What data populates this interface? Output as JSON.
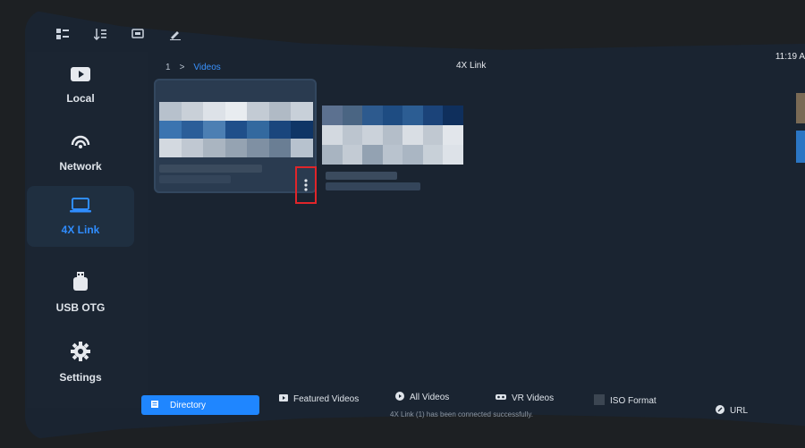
{
  "topbar": {
    "icons": [
      "grid-list-icon",
      "sort-icon",
      "screen-icon",
      "edit-icon"
    ]
  },
  "sidebar": {
    "items": [
      {
        "label": "Local",
        "icon": "play-folder-icon"
      },
      {
        "label": "Network",
        "icon": "network-icon"
      },
      {
        "label": "4X Link",
        "icon": "laptop-icon",
        "active": true
      },
      {
        "label": "USB OTG",
        "icon": "usb-icon"
      },
      {
        "label": "Settings",
        "icon": "gear-icon"
      }
    ]
  },
  "header": {
    "breadcrumb_root": "1",
    "breadcrumb_sep": ">",
    "breadcrumb_current": "Videos",
    "title": "4X Link",
    "clock": "11:19 A"
  },
  "bottom": {
    "tabs": [
      {
        "label": "Directory",
        "icon": "directory-icon",
        "active": true
      },
      {
        "label": "Featured Videos",
        "icon": "featured-icon"
      },
      {
        "label": "All Videos",
        "icon": "all-videos-icon"
      },
      {
        "label": "VR Videos",
        "icon": "vr-icon"
      },
      {
        "label": "ISO Format",
        "icon": "iso-icon"
      },
      {
        "label": "URL",
        "icon": "url-icon"
      }
    ],
    "status": "4X Link (1) has been connected successfully."
  },
  "colors": {
    "accent": "#1f86ff",
    "highlight_box": "#e0252a",
    "panel": "#1a2431"
  }
}
